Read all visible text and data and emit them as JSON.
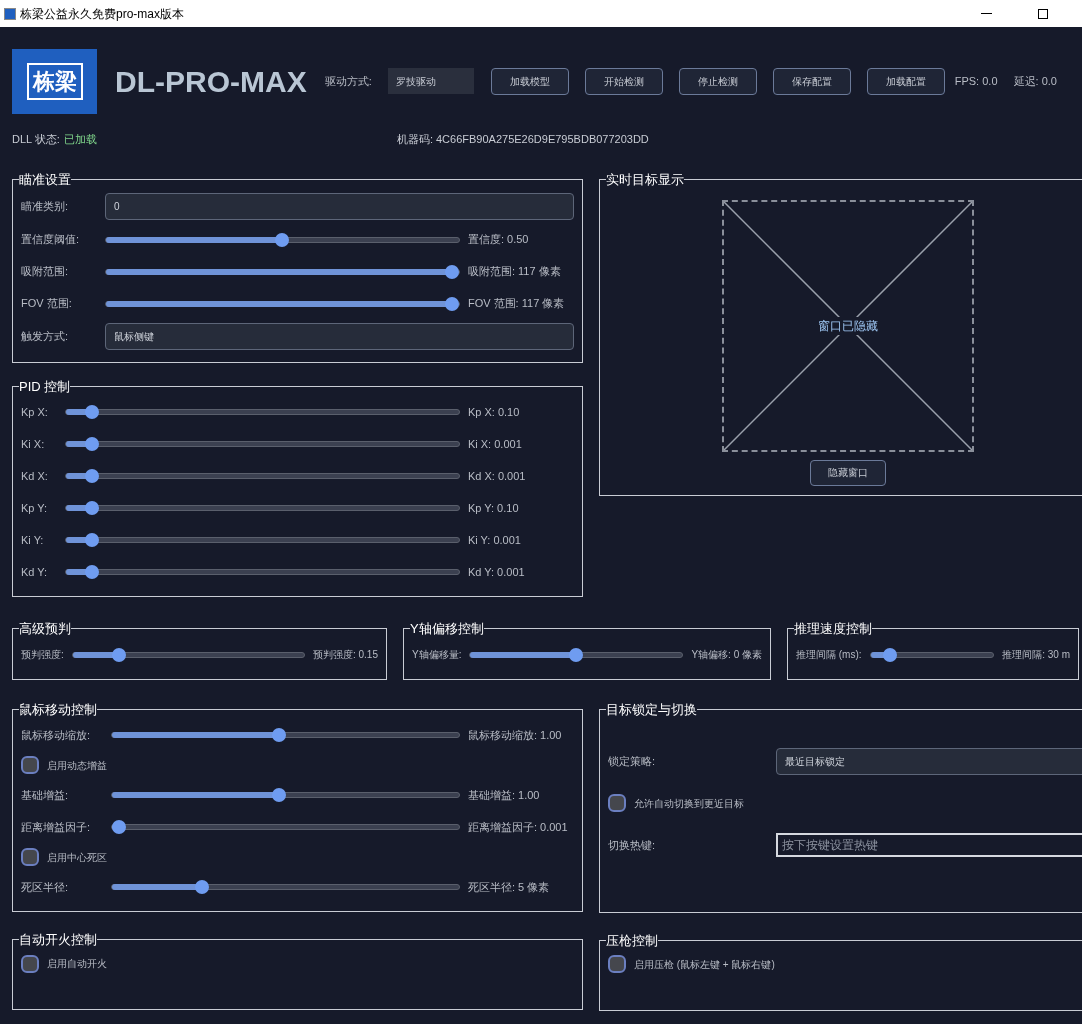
{
  "window": {
    "title": "栋梁公益永久免费pro-max版本"
  },
  "header": {
    "logo_text": "栋梁",
    "app_name": "DL-PRO-MAX",
    "driver_label": "驱动方式:",
    "driver_value": "罗技驱动",
    "buttons": [
      "加载模型",
      "开始检测",
      "停止检测",
      "保存配置",
      "加载配置"
    ],
    "fps": "FPS: 0.0",
    "latency": "延迟: 0.0",
    "dll_label": "DLL 状态:",
    "dll_value": "已加载",
    "machine_code": "机器码: 4C66FB90A275E26D9E795BDB077203DD"
  },
  "aim_settings": {
    "title": "瞄准设置",
    "rows": [
      {
        "kind": "field",
        "label": "瞄准类别:",
        "value": "0"
      },
      {
        "kind": "slider",
        "label": "置信度阈值:",
        "level": 0.5,
        "reading": "置信度: 0.50"
      },
      {
        "kind": "slider",
        "label": "吸附范围:",
        "level": 0.98,
        "reading": "吸附范围: 117 像素"
      },
      {
        "kind": "slider",
        "label": "FOV 范围:",
        "level": 0.98,
        "reading": "FOV 范围: 117 像素"
      },
      {
        "kind": "field",
        "label": "触发方式:",
        "value": "鼠标侧键"
      }
    ]
  },
  "pid": {
    "title": "PID 控制",
    "rows": [
      {
        "kind": "slider",
        "label": "Kp X:",
        "level": 0.065,
        "reading": "Kp X: 0.10"
      },
      {
        "kind": "slider",
        "label": "Ki X:",
        "level": 0.065,
        "reading": "Ki X: 0.001"
      },
      {
        "kind": "slider",
        "label": "Kd X:",
        "level": 0.065,
        "reading": "Kd X: 0.001"
      },
      {
        "kind": "slider",
        "label": "Kp Y:",
        "level": 0.065,
        "reading": "Kp Y: 0.10"
      },
      {
        "kind": "slider",
        "label": "Ki Y:",
        "level": 0.065,
        "reading": "Ki Y: 0.001"
      },
      {
        "kind": "slider",
        "label": "Kd Y:",
        "level": 0.065,
        "reading": "Kd Y: 0.001"
      }
    ]
  },
  "realtime_display": {
    "title": "实时目标显示",
    "placeholder": "窗口已隐藏",
    "button": "隐藏窗口"
  },
  "middle_groups": [
    {
      "title": "高级预判",
      "label": "预判强度:",
      "level": 0.2,
      "reading": "预判强度: 0.15"
    },
    {
      "title": "Y轴偏移控制",
      "label": "Y轴偏移量:",
      "level": 0.5,
      "reading": "Y轴偏移: 0 像素"
    },
    {
      "title": "推理速度控制",
      "label": "推理间隔 (ms):",
      "level": 0.16,
      "reading": "推理间隔: 30 m"
    }
  ],
  "mouse_move": {
    "title": "鼠标移动控制",
    "rows": [
      {
        "kind": "slider",
        "label": "鼠标移动缩放:",
        "level": 0.48,
        "reading": "鼠标移动缩放: 1.00"
      },
      {
        "kind": "checkbox",
        "label": "启用动态增益",
        "checked": false
      },
      {
        "kind": "slider",
        "label": "基础增益:",
        "level": 0.48,
        "reading": "基础增益: 1.00"
      },
      {
        "kind": "slider",
        "label": "距离增益因子:",
        "level": 0.02,
        "reading": "距离增益因子: 0.001"
      },
      {
        "kind": "checkbox",
        "label": "启用中心死区",
        "checked": false
      },
      {
        "kind": "slider",
        "label": "死区半径:",
        "level": 0.26,
        "reading": "死区半径: 5 像素"
      }
    ]
  },
  "target_lock": {
    "title": "目标锁定与切换",
    "rows": [
      {
        "kind": "select",
        "label": "锁定策略:",
        "value": "最近目标锁定"
      },
      {
        "kind": "checkbox",
        "label": "允许自动切换到更近目标",
        "checked": false
      },
      {
        "kind": "hotkey",
        "label": "切换热键:",
        "placeholder": "按下按键设置热键"
      }
    ]
  },
  "auto_fire": {
    "title": "自动开火控制",
    "rows": [
      {
        "kind": "checkbox",
        "label": "启用自动开火",
        "checked": false
      }
    ]
  },
  "recoil": {
    "title": "压枪控制",
    "rows": [
      {
        "kind": "checkbox",
        "label": "启用压枪 (鼠标左键 + 鼠标右键)",
        "checked": false
      }
    ]
  }
}
